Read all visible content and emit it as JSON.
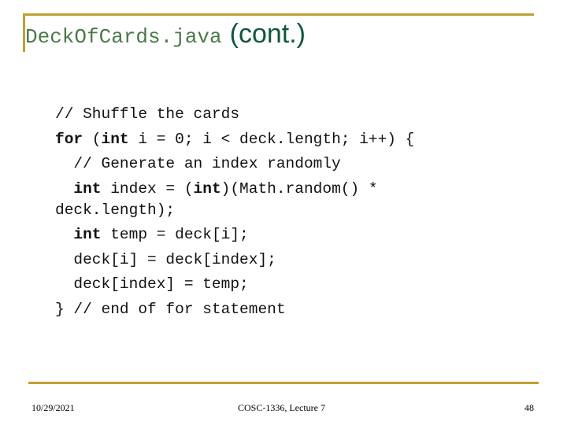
{
  "slide": {
    "title_code": "DeckOfCards.java",
    "title_suffix": "(cont.)",
    "accent_color": "#c0a030",
    "title_color": "#0b5a38"
  },
  "code": {
    "lines": [
      [
        {
          "t": "// Shuffle the cards",
          "kw": false
        }
      ],
      [
        {
          "t": "for",
          "kw": true
        },
        {
          "t": " (",
          "kw": false
        },
        {
          "t": "int",
          "kw": true
        },
        {
          "t": " i = 0; i < deck.length; i++) {",
          "kw": false
        }
      ],
      [
        {
          "t": "  // Generate an index randomly",
          "kw": false
        }
      ],
      [
        {
          "t": "  ",
          "kw": false
        },
        {
          "t": "int",
          "kw": true
        },
        {
          "t": " index = (",
          "kw": false
        },
        {
          "t": "int",
          "kw": true
        },
        {
          "t": ")(Math.random() *",
          "kw": false
        }
      ],
      [
        {
          "t": "deck.length);",
          "kw": false
        }
      ],
      [
        {
          "t": "  ",
          "kw": false
        },
        {
          "t": "int",
          "kw": true
        },
        {
          "t": " temp = deck[i];",
          "kw": false
        }
      ],
      [
        {
          "t": "  deck[i] = deck[index];",
          "kw": false
        }
      ],
      [
        {
          "t": "  deck[index] = temp;",
          "kw": false
        }
      ],
      [
        {
          "t": "} // end of for statement",
          "kw": false
        }
      ]
    ]
  },
  "footer": {
    "date": "10/29/2021",
    "course": "COSC-1336, Lecture 7",
    "page": "48"
  }
}
